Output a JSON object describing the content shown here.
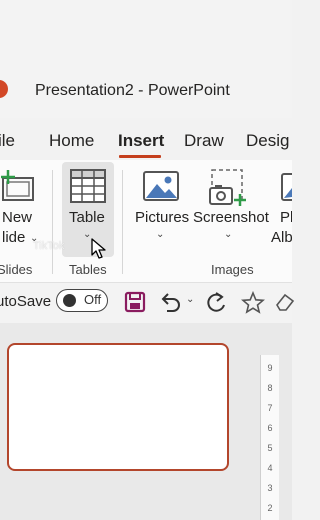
{
  "window": {
    "title": "Presentation2  -  PowerPoint"
  },
  "tabs": [
    {
      "label": "ile"
    },
    {
      "label": "Home"
    },
    {
      "label": "Insert"
    },
    {
      "label": "Draw"
    },
    {
      "label": "Desig"
    }
  ],
  "ribbon": {
    "new_slide": {
      "line1": "New",
      "line2": "lide"
    },
    "table": {
      "label": "Table"
    },
    "pictures": {
      "label": "Pictures"
    },
    "screenshot": {
      "label": "Screenshot"
    },
    "photo_album": {
      "line1": "Pl",
      "line2": "Alb"
    },
    "groups": {
      "slides": "Slides",
      "tables": "Tables",
      "images": "Images"
    }
  },
  "quick_access": {
    "autosave_label": "utoSave",
    "autosave_state": "Off"
  },
  "watermark": "TikTok",
  "ruler": [
    "9",
    "8",
    "7",
    "6",
    "5",
    "4",
    "3",
    "2"
  ],
  "colors": {
    "accent": "#c43e1c",
    "app_icon": "#d24726",
    "save_icon": "#8a1c5f",
    "slide_border": "#b3462c",
    "screenshot_plus": "#2f9b48"
  }
}
